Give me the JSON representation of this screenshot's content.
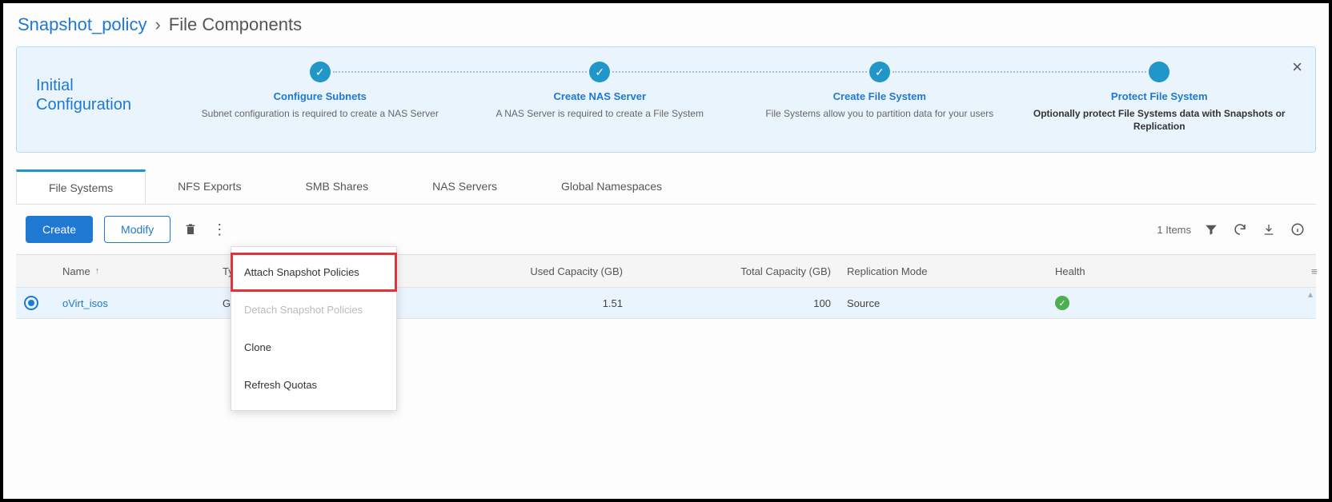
{
  "breadcrumb": {
    "root": "Snapshot_policy",
    "current": "File Components"
  },
  "banner": {
    "title": "Initial Configuration",
    "steps": [
      {
        "title": "Configure Subnets",
        "desc": "Subnet configuration is required to create a NAS Server",
        "icon": "check"
      },
      {
        "title": "Create NAS Server",
        "desc": "A NAS Server is required to create a File System",
        "icon": "check"
      },
      {
        "title": "Create File System",
        "desc": "File Systems allow you to partition data for your users",
        "icon": "check"
      },
      {
        "title": "Protect File System",
        "desc": "Optionally protect File Systems data with Snapshots or Replication",
        "icon": "shield",
        "bold": true
      }
    ]
  },
  "tabs": [
    "File Systems",
    "NFS Exports",
    "SMB Shares",
    "NAS Servers",
    "Global Namespaces"
  ],
  "active_tab": 0,
  "toolbar": {
    "create": "Create",
    "modify": "Modify",
    "items_label": "1 Items"
  },
  "dropdown": {
    "items": [
      {
        "label": "Attach Snapshot Policies",
        "state": "highlighted"
      },
      {
        "label": "Detach Snapshot Policies",
        "state": "disabled"
      },
      {
        "label": "Clone",
        "state": "normal"
      },
      {
        "label": "Refresh Quotas",
        "state": "normal"
      }
    ]
  },
  "table": {
    "columns": [
      "Name",
      "Type",
      "Used Capacity (GB)",
      "Total Capacity (GB)",
      "Replication Mode",
      "Health"
    ],
    "sort_column": "Name",
    "sort_dir": "asc",
    "rows": [
      {
        "selected": true,
        "name": "oVirt_isos",
        "type": "General",
        "used": "1.51",
        "total": "100",
        "repl": "Source",
        "health": "ok"
      }
    ]
  }
}
